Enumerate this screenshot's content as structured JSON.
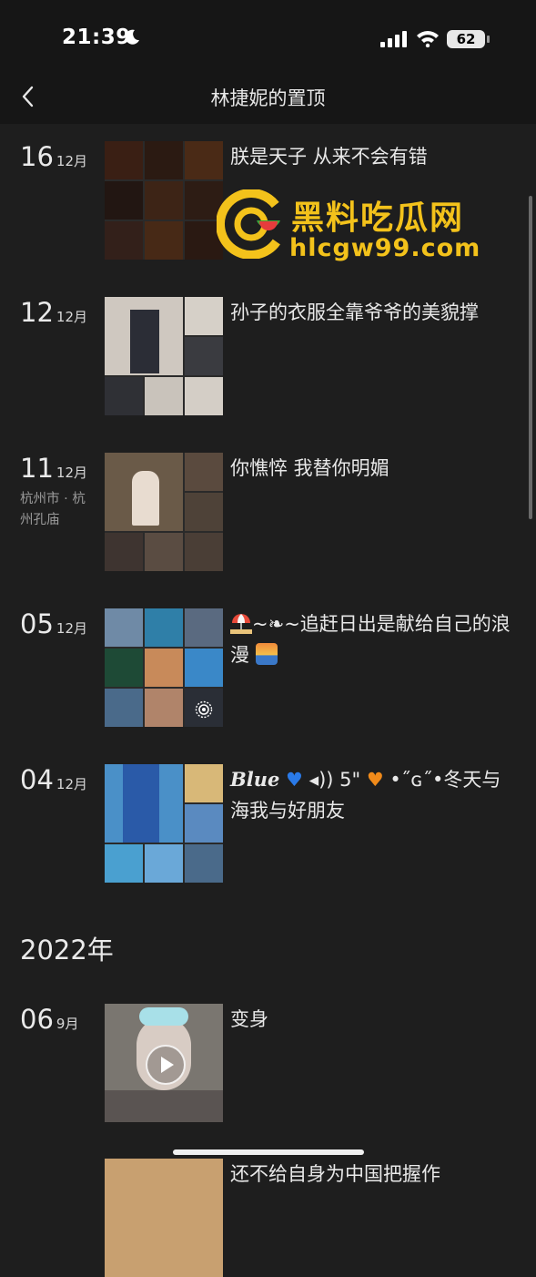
{
  "status_bar": {
    "time": "21:39",
    "battery": "62"
  },
  "nav": {
    "title": "林捷妮的置顶"
  },
  "watermark": {
    "name": "黑料吃瓜网",
    "url": "hlcgw99.com"
  },
  "entries": [
    {
      "day": "16",
      "month": "12月",
      "location": "",
      "caption": "朕是天子 从来不会有错"
    },
    {
      "day": "12",
      "month": "12月",
      "location": "",
      "caption": "孙子的衣服全靠爷爷的美貌撑"
    },
    {
      "day": "11",
      "month": "12月",
      "location": "杭州市 · 杭州孔庙",
      "caption": "你憔悴 我替你明媚"
    },
    {
      "day": "05",
      "month": "12月",
      "location": "",
      "caption_a": "~❧~追赶日出是献给自己的浪漫"
    },
    {
      "day": "04",
      "month": "12月",
      "location": "",
      "caption_a": "Blue",
      "caption_b": " ◂)) 5\"",
      "caption_c": "•˝ɢ˝•冬天与海我与好朋友"
    },
    {
      "day": "06",
      "month": "9月",
      "location": "",
      "caption": "变身"
    },
    {
      "day": "",
      "month": "",
      "location": "",
      "caption": "还不给自身为中国把握作"
    }
  ],
  "year_header": "2022年",
  "colors": {
    "background": "#1e1e1e",
    "bar": "#161616",
    "watermark": "#f3c21b"
  }
}
